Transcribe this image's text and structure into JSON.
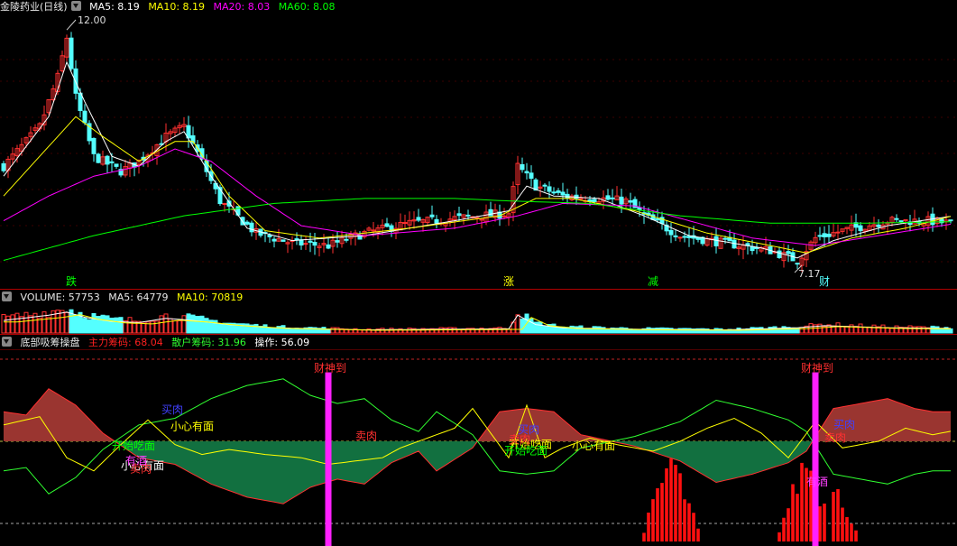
{
  "price_panel": {
    "title": "金陵药业(日线)",
    "ma5_label": "MA5: 8.19",
    "ma10_label": "MA10: 8.19",
    "ma20_label": "MA20: 8.03",
    "ma60_label": "MA60: 8.08",
    "colors": {
      "ma5": "#ffffff",
      "ma10": "#ffff00",
      "ma20": "#ff00ff",
      "ma60": "#00ff00",
      "up": "#ff3030",
      "down": "#54ffff"
    }
  },
  "volume_panel": {
    "volume_label": "VOLUME: 57753",
    "ma5_label": "MA5: 64779",
    "ma10_label": "MA10: 70819"
  },
  "indicator_panel": {
    "name": "底部吸筹操盘",
    "main_label": "主力筹码: 68.04",
    "retail_label": "散户筹码: 31.96",
    "op_label": "操作: 56.09",
    "colors": {
      "main": "#ff2020",
      "retail": "#30ff30",
      "op": "#ffffff"
    }
  },
  "chart_data": [
    {
      "type": "candlestick",
      "title": "金陵药业(日线)",
      "annotations": [
        {
          "text": "12.00",
          "kind": "high_marker"
        },
        {
          "text": "7.17",
          "kind": "low_marker"
        },
        {
          "text": "跌",
          "kind": "signal"
        },
        {
          "text": "涨",
          "kind": "signal"
        },
        {
          "text": "减",
          "kind": "signal"
        },
        {
          "text": "财",
          "kind": "signal"
        }
      ],
      "close_pivots": [
        [
          0,
          9.2
        ],
        [
          8,
          10.0
        ],
        [
          12,
          11.0
        ],
        [
          14,
          11.8
        ],
        [
          16,
          10.6
        ],
        [
          20,
          9.4
        ],
        [
          26,
          9.1
        ],
        [
          30,
          9.3
        ],
        [
          36,
          9.8
        ],
        [
          40,
          10.0
        ],
        [
          44,
          9.3
        ],
        [
          48,
          8.5
        ],
        [
          56,
          7.85
        ],
        [
          64,
          7.65
        ],
        [
          72,
          7.6
        ],
        [
          80,
          7.85
        ],
        [
          90,
          8.05
        ],
        [
          100,
          8.15
        ],
        [
          112,
          8.25
        ],
        [
          114,
          9.2
        ],
        [
          118,
          8.8
        ],
        [
          124,
          8.6
        ],
        [
          132,
          8.55
        ],
        [
          138,
          8.5
        ],
        [
          142,
          8.2
        ],
        [
          150,
          7.8
        ],
        [
          160,
          7.65
        ],
        [
          170,
          7.5
        ],
        [
          176,
          7.3
        ],
        [
          180,
          7.75
        ],
        [
          186,
          7.9
        ],
        [
          196,
          8.1
        ],
        [
          205,
          8.1
        ],
        [
          210,
          8.05
        ]
      ],
      "ma_series": [
        {
          "name": "MA5",
          "pivots": [
            [
              0,
              9.0
            ],
            [
              10,
              10.2
            ],
            [
              14,
              11.3
            ],
            [
              18,
              10.5
            ],
            [
              24,
              9.4
            ],
            [
              30,
              9.2
            ],
            [
              36,
              9.7
            ],
            [
              40,
              9.9
            ],
            [
              46,
              9.0
            ],
            [
              54,
              7.95
            ],
            [
              64,
              7.7
            ],
            [
              80,
              7.8
            ],
            [
              100,
              8.1
            ],
            [
              112,
              8.3
            ],
            [
              116,
              8.8
            ],
            [
              122,
              8.6
            ],
            [
              132,
              8.55
            ],
            [
              142,
              8.2
            ],
            [
              152,
              7.8
            ],
            [
              168,
              7.55
            ],
            [
              176,
              7.35
            ],
            [
              184,
              7.7
            ],
            [
              196,
              8.0
            ],
            [
              210,
              8.19
            ]
          ]
        },
        {
          "name": "MA10",
          "pivots": [
            [
              0,
              8.6
            ],
            [
              10,
              9.6
            ],
            [
              16,
              10.2
            ],
            [
              22,
              9.8
            ],
            [
              30,
              9.3
            ],
            [
              38,
              9.7
            ],
            [
              42,
              9.7
            ],
            [
              50,
              8.6
            ],
            [
              58,
              7.9
            ],
            [
              70,
              7.75
            ],
            [
              90,
              7.95
            ],
            [
              110,
              8.2
            ],
            [
              118,
              8.55
            ],
            [
              126,
              8.55
            ],
            [
              140,
              8.3
            ],
            [
              156,
              7.85
            ],
            [
              170,
              7.6
            ],
            [
              178,
              7.45
            ],
            [
              188,
              7.75
            ],
            [
              200,
              7.95
            ],
            [
              210,
              8.19
            ]
          ]
        },
        {
          "name": "MA20",
          "pivots": [
            [
              0,
              8.1
            ],
            [
              10,
              8.6
            ],
            [
              20,
              9.0
            ],
            [
              30,
              9.2
            ],
            [
              38,
              9.55
            ],
            [
              46,
              9.3
            ],
            [
              56,
              8.6
            ],
            [
              66,
              8.0
            ],
            [
              80,
              7.8
            ],
            [
              100,
              7.95
            ],
            [
              114,
              8.2
            ],
            [
              124,
              8.45
            ],
            [
              140,
              8.4
            ],
            [
              152,
              8.1
            ],
            [
              166,
              7.75
            ],
            [
              180,
              7.6
            ],
            [
              194,
              7.8
            ],
            [
              210,
              8.03
            ]
          ]
        },
        {
          "name": "MA60",
          "pivots": [
            [
              0,
              7.3
            ],
            [
              20,
              7.8
            ],
            [
              40,
              8.2
            ],
            [
              60,
              8.45
            ],
            [
              80,
              8.55
            ],
            [
              100,
              8.55
            ],
            [
              112,
              8.5
            ],
            [
              130,
              8.45
            ],
            [
              150,
              8.2
            ],
            [
              170,
              8.05
            ],
            [
              190,
              8.05
            ],
            [
              210,
              8.08
            ]
          ]
        }
      ],
      "ylim": [
        7.0,
        12.3
      ]
    },
    {
      "type": "bar",
      "title": "VOLUME: 57753",
      "volume_pivots": [
        [
          0,
          60
        ],
        [
          10,
          85
        ],
        [
          14,
          100
        ],
        [
          18,
          75
        ],
        [
          24,
          55
        ],
        [
          30,
          50
        ],
        [
          36,
          70
        ],
        [
          42,
          60
        ],
        [
          50,
          40
        ],
        [
          60,
          25
        ],
        [
          80,
          15
        ],
        [
          100,
          18
        ],
        [
          112,
          20
        ],
        [
          114,
          85
        ],
        [
          118,
          40
        ],
        [
          124,
          25
        ],
        [
          140,
          18
        ],
        [
          160,
          15
        ],
        [
          176,
          25
        ],
        [
          182,
          35
        ],
        [
          196,
          25
        ],
        [
          210,
          22
        ]
      ],
      "volume_unit": "percent_of_panel_max"
    },
    {
      "type": "area",
      "title": "底部吸筹操盘",
      "series": [
        {
          "name": "主力筹码",
          "pivots": [
            [
              0,
              68
            ],
            [
              5,
              66
            ],
            [
              10,
              82
            ],
            [
              16,
              72
            ],
            [
              22,
              55
            ],
            [
              30,
              40
            ],
            [
              38,
              36
            ],
            [
              46,
              24
            ],
            [
              54,
              16
            ],
            [
              62,
              12
            ],
            [
              68,
              22
            ],
            [
              74,
              27
            ],
            [
              80,
              24
            ],
            [
              86,
              37
            ],
            [
              92,
              44
            ],
            [
              96,
              32
            ],
            [
              104,
              46
            ],
            [
              110,
              68
            ],
            [
              116,
              70
            ],
            [
              122,
              68
            ],
            [
              128,
              54
            ],
            [
              140,
              47
            ],
            [
              150,
              38
            ],
            [
              158,
              25
            ],
            [
              166,
              30
            ],
            [
              174,
              37
            ],
            [
              178,
              44
            ],
            [
              184,
              70
            ],
            [
              190,
              73
            ],
            [
              196,
              76
            ],
            [
              202,
              70
            ],
            [
              206,
              68
            ],
            [
              210,
              68.04
            ]
          ]
        },
        {
          "name": "散户筹码",
          "pivots": [
            [
              0,
              32
            ],
            [
              5,
              34
            ],
            [
              10,
              18
            ],
            [
              16,
              28
            ],
            [
              22,
              45
            ],
            [
              30,
              60
            ],
            [
              38,
              64
            ],
            [
              46,
              76
            ],
            [
              54,
              84
            ],
            [
              62,
              88
            ],
            [
              68,
              78
            ],
            [
              74,
              73
            ],
            [
              80,
              76
            ],
            [
              86,
              63
            ],
            [
              92,
              56
            ],
            [
              96,
              68
            ],
            [
              104,
              54
            ],
            [
              110,
              32
            ],
            [
              116,
              30
            ],
            [
              122,
              32
            ],
            [
              128,
              46
            ],
            [
              140,
              53
            ],
            [
              150,
              62
            ],
            [
              158,
              75
            ],
            [
              166,
              70
            ],
            [
              174,
              63
            ],
            [
              178,
              56
            ],
            [
              184,
              30
            ],
            [
              190,
              27
            ],
            [
              196,
              24
            ],
            [
              202,
              30
            ],
            [
              206,
              32
            ],
            [
              210,
              31.96
            ]
          ]
        },
        {
          "name": "操作",
          "pivots": [
            [
              0,
              60
            ],
            [
              8,
              65
            ],
            [
              14,
              40
            ],
            [
              20,
              32
            ],
            [
              26,
              48
            ],
            [
              32,
              63
            ],
            [
              38,
              48
            ],
            [
              44,
              42
            ],
            [
              50,
              45
            ],
            [
              58,
              42
            ],
            [
              66,
              40
            ],
            [
              72,
              36
            ],
            [
              78,
              38
            ],
            [
              84,
              40
            ],
            [
              88,
              46
            ],
            [
              94,
              52
            ],
            [
              100,
              58
            ],
            [
              104,
              70
            ],
            [
              112,
              40
            ],
            [
              116,
              72
            ],
            [
              120,
              40
            ],
            [
              124,
              46
            ],
            [
              130,
              52
            ],
            [
              136,
              48
            ],
            [
              144,
              44
            ],
            [
              150,
              50
            ],
            [
              156,
              58
            ],
            [
              162,
              64
            ],
            [
              168,
              55
            ],
            [
              174,
              40
            ],
            [
              180,
              62
            ],
            [
              186,
              46
            ],
            [
              194,
              50
            ],
            [
              200,
              58
            ],
            [
              206,
              54
            ],
            [
              210,
              56.09
            ]
          ]
        }
      ],
      "signals": [
        {
          "name": "财神到",
          "index": 72
        },
        {
          "name": "财神到",
          "index": 180
        }
      ],
      "annotations": [
        "开始吃面",
        "小心有面",
        "小心有面",
        "买肉",
        "卖肉",
        "开始吃面",
        "小心有面",
        "买肉",
        "有酒",
        "有酒",
        "卖肉",
        "开始吃面",
        "卖肉",
        "买肉",
        "卖肉"
      ],
      "ylim": [
        0,
        100
      ]
    }
  ]
}
